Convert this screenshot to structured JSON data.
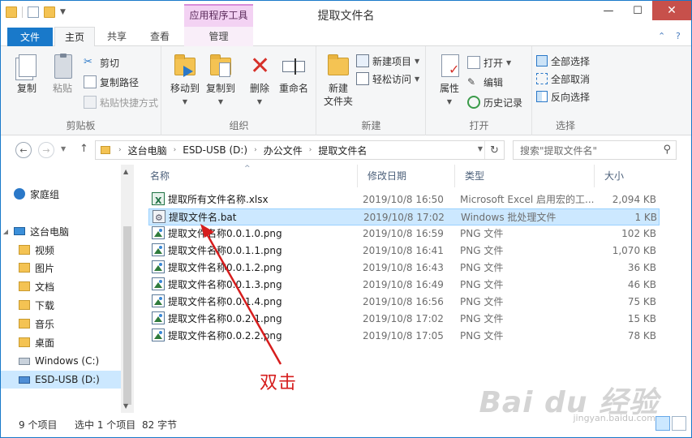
{
  "window": {
    "title": "提取文件名",
    "context_tab_header": "应用程序工具",
    "buttons": {
      "minimize": "—",
      "maximize": "☐",
      "close": "✕"
    }
  },
  "tabs": [
    {
      "label": "文件"
    },
    {
      "label": "主页"
    },
    {
      "label": "共享"
    },
    {
      "label": "查看"
    },
    {
      "label": "管理"
    }
  ],
  "ribbon": {
    "clipboard": {
      "label": "剪贴板",
      "copy": "复制",
      "paste": "粘贴",
      "cut": "剪切",
      "copy_path": "复制路径",
      "paste_shortcut": "粘贴快捷方式"
    },
    "organize": {
      "label": "组织",
      "move_to": "移动到",
      "copy_to": "复制到",
      "delete": "删除",
      "rename": "重命名"
    },
    "new": {
      "label": "新建",
      "new_folder_line1": "新建",
      "new_folder_line2": "文件夹",
      "new_item": "新建项目",
      "easy_access": "轻松访问"
    },
    "open": {
      "label": "打开",
      "properties": "属性",
      "open": "打开",
      "edit": "编辑",
      "history": "历史记录"
    },
    "select": {
      "label": "选择",
      "select_all": "全部选择",
      "select_none": "全部取消",
      "invert": "反向选择"
    }
  },
  "address": {
    "crumbs": [
      "这台电脑",
      "ESD-USB (D:)",
      "办公文件",
      "提取文件名"
    ],
    "search_placeholder": "搜索\"提取文件名\""
  },
  "navpane": {
    "items": [
      {
        "label": "家庭组",
        "icon": "homegroup-icon"
      },
      {
        "label": "这台电脑",
        "icon": "computer-icon"
      },
      {
        "label": "视频",
        "icon": "folder-icon"
      },
      {
        "label": "图片",
        "icon": "folder-icon"
      },
      {
        "label": "文档",
        "icon": "folder-icon"
      },
      {
        "label": "下载",
        "icon": "folder-icon"
      },
      {
        "label": "音乐",
        "icon": "music-folder-icon"
      },
      {
        "label": "桌面",
        "icon": "folder-icon"
      },
      {
        "label": "Windows (C:)",
        "icon": "drive-icon"
      },
      {
        "label": "ESD-USB (D:)",
        "icon": "usb-drive-icon"
      }
    ]
  },
  "columns": {
    "name": "名称",
    "date": "修改日期",
    "type": "类型",
    "size": "大小"
  },
  "files": [
    {
      "name": "提取所有文件名称.xlsx",
      "date": "2019/10/8 16:50",
      "type": "Microsoft Excel 启用宏的工...",
      "size": "2,094 KB",
      "icon": "xlsx"
    },
    {
      "name": "提取文件名.bat",
      "date": "2019/10/8 17:02",
      "type": "Windows 批处理文件",
      "size": "1 KB",
      "icon": "bat"
    },
    {
      "name": "提取文件名称0.0.1.0.png",
      "date": "2019/10/8 16:59",
      "type": "PNG 文件",
      "size": "102 KB",
      "icon": "png"
    },
    {
      "name": "提取文件名称0.0.1.1.png",
      "date": "2019/10/8 16:41",
      "type": "PNG 文件",
      "size": "1,070 KB",
      "icon": "png"
    },
    {
      "name": "提取文件名称0.0.1.2.png",
      "date": "2019/10/8 16:43",
      "type": "PNG 文件",
      "size": "36 KB",
      "icon": "png"
    },
    {
      "name": "提取文件名称0.0.1.3.png",
      "date": "2019/10/8 16:49",
      "type": "PNG 文件",
      "size": "46 KB",
      "icon": "png"
    },
    {
      "name": "提取文件名称0.0.1.4.png",
      "date": "2019/10/8 16:56",
      "type": "PNG 文件",
      "size": "75 KB",
      "icon": "png"
    },
    {
      "name": "提取文件名称0.0.2.1.png",
      "date": "2019/10/8 17:02",
      "type": "PNG 文件",
      "size": "15 KB",
      "icon": "png"
    },
    {
      "name": "提取文件名称0.0.2.2.png",
      "date": "2019/10/8 17:05",
      "type": "PNG 文件",
      "size": "78 KB",
      "icon": "png"
    }
  ],
  "status": {
    "count": "9 个项目",
    "selected": "选中 1 个项目",
    "size": "82 字节"
  },
  "annotation": {
    "text": "双击",
    "color": "#d61d1d"
  },
  "watermark": {
    "text": "Bai du 经验",
    "sub": "jingyan.baidu.com"
  },
  "colors": {
    "accent": "#1979ca",
    "selection": "#cce8ff",
    "context_tab": "#f3d2f3"
  }
}
